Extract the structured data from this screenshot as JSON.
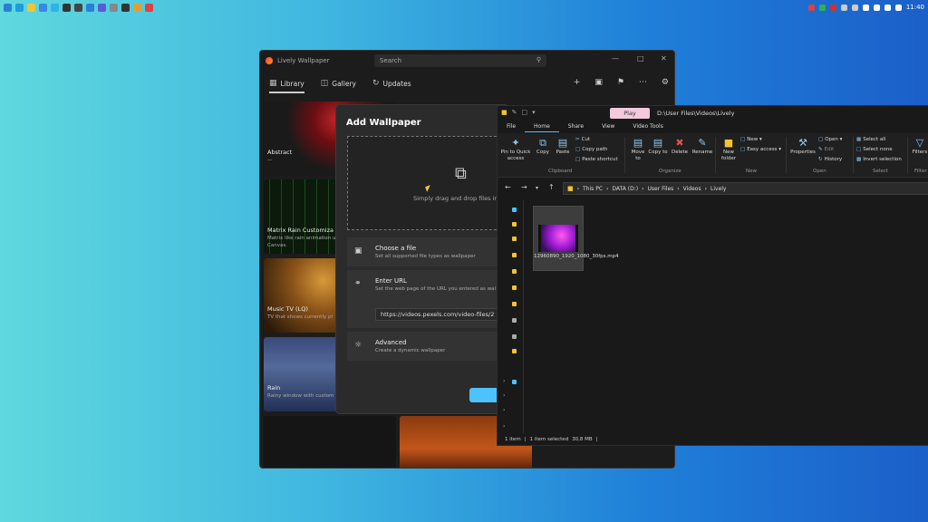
{
  "taskbar": {
    "left_icons": [
      "windows-icon",
      "edge-icon",
      "folder-icon",
      "mail-icon",
      "photos-icon",
      "terminal-icon",
      "store-icon",
      "vscode-icon",
      "teams-icon",
      "settings-icon",
      "obs-icon",
      "chrome-icon",
      "lively-icon"
    ],
    "right_icons": [
      "app-tray-icon",
      "green-app-icon",
      "red-app-icon",
      "mic-icon",
      "camera-icon",
      "wifi-icon",
      "volume-icon",
      "battery-icon",
      "notifications-icon"
    ],
    "clock": "11:40"
  },
  "lively": {
    "title": "Lively Wallpaper",
    "search_placeholder": "Search",
    "nav": [
      {
        "label": "Library",
        "icon": "grid-icon",
        "active": true
      },
      {
        "label": "Gallery",
        "icon": "bag-icon",
        "active": false
      },
      {
        "label": "Updates",
        "icon": "refresh-icon",
        "active": false
      }
    ],
    "cards": [
      {
        "title": "Abstract",
        "desc": "—"
      },
      {
        "title": "Matrix Rain Customiza",
        "desc": "Matrix like rain animation u",
        "desc2": "Canvas."
      },
      {
        "title": "Music TV (LQ)",
        "desc": "TV that shows currently pl"
      },
      {
        "title": "Rain",
        "desc": "Rainy window with custom"
      }
    ]
  },
  "dialog": {
    "title": "Add Wallpaper",
    "drop_text": "Simply drag and drop files in",
    "choose_file": {
      "title": "Choose a file",
      "desc": "Set all supported file types as wallpaper"
    },
    "enter_url": {
      "title": "Enter URL",
      "desc": "Set the web page of the URL you entered as wal",
      "value": "https://videos.pexels.com/video-files/2"
    },
    "advanced": {
      "title": "Advanced",
      "desc": "Create a dynamic wallpaper"
    }
  },
  "explorer": {
    "play_tab": "Play",
    "title_path": "D:\\User Files\\Videos\\Lively",
    "tabs": [
      "File",
      "Home",
      "Share",
      "View",
      "Video Tools"
    ],
    "active_tab": "Home",
    "ribbon": {
      "pin": "Pin to Quick access",
      "copy": "Copy",
      "paste": "Paste",
      "cut": "Cut",
      "copy_path": "Copy path",
      "paste_shortcut": "Paste shortcut",
      "move_to": "Move to",
      "copy_to": "Copy to",
      "delete": "Delete",
      "rename": "Rename",
      "new_folder": "New folder",
      "new_item": "New",
      "easy_access": "Easy access",
      "properties": "Properties",
      "open": "Open",
      "edit": "Edit",
      "history": "History",
      "select_all": "Select all",
      "select_none": "Select none",
      "invert": "Invert selection",
      "filters": "Filters",
      "groups": [
        "Clipboard",
        "Organize",
        "New",
        "Open",
        "Select",
        "Filter"
      ]
    },
    "breadcrumb": [
      "This PC",
      "DATA (D:)",
      "User Files",
      "Videos",
      "Lively"
    ],
    "file": {
      "name": "12960890_1920_1080_30fps.mp4"
    },
    "status": {
      "items": "1 item",
      "selected": "1 item selected",
      "size": "30,8 MB"
    }
  }
}
